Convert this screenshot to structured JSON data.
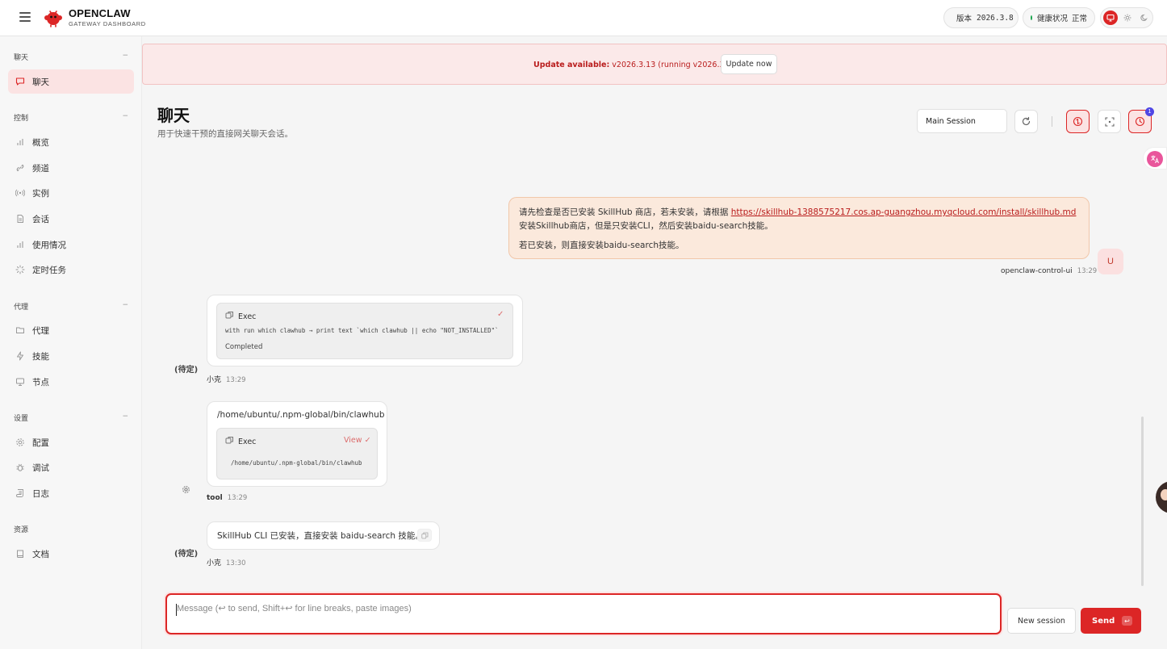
{
  "brand": {
    "title": "OPENCLAW",
    "subtitle": "GATEWAY DASHBOARD"
  },
  "status": {
    "version_label": "版本",
    "version_value": "2026.3.8",
    "version_dot_color": "#f59e0b",
    "health_label": "健康状况",
    "health_value": "正常",
    "health_dot_color": "#16a34a"
  },
  "theme": {
    "options": [
      "monitor-icon",
      "sun-icon",
      "moon-icon"
    ],
    "active": "monitor-icon"
  },
  "sidebar": {
    "sections": [
      {
        "title": "聊天",
        "items": [
          {
            "label": "聊天",
            "icon": "chat-bubble-icon",
            "active": true
          }
        ]
      },
      {
        "title": "控制",
        "items": [
          {
            "label": "概览",
            "icon": "bar-chart-icon"
          },
          {
            "label": "频道",
            "icon": "link-icon"
          },
          {
            "label": "实例",
            "icon": "radio-icon"
          },
          {
            "label": "会话",
            "icon": "document-icon"
          },
          {
            "label": "使用情况",
            "icon": "bar-chart-icon"
          },
          {
            "label": "定时任务",
            "icon": "loader-icon"
          }
        ]
      },
      {
        "title": "代理",
        "items": [
          {
            "label": "代理",
            "icon": "folder-icon"
          },
          {
            "label": "技能",
            "icon": "lightning-icon"
          },
          {
            "label": "节点",
            "icon": "monitor-icon"
          }
        ]
      },
      {
        "title": "设置",
        "items": [
          {
            "label": "配置",
            "icon": "gear-icon"
          },
          {
            "label": "调试",
            "icon": "bug-icon"
          },
          {
            "label": "日志",
            "icon": "scroll-icon"
          }
        ]
      },
      {
        "title": "资源",
        "items": [
          {
            "label": "文档",
            "icon": "book-icon"
          }
        ]
      }
    ],
    "collapse_glyph": "−"
  },
  "banner": {
    "prefix": "Update available:",
    "message": " v2026.3.13 (running v2026.3.8).",
    "button": "Update now"
  },
  "page": {
    "title": "聊天",
    "subtitle": "用于快速干预的直接网关聊天会话。",
    "session_select": "Main Session",
    "notification_count": "1"
  },
  "messages": {
    "user": {
      "line1_prefix": "请先检查是否已安装 SkillHub 商店，若未安装，请根据 ",
      "link": "https://skillhub-1388575217.cos.ap-guangzhou.myqcloud.com/install/skillhub.md",
      "line1_suffix": " 安装Skillhub商店，但是只安装CLI，然后安装baidu-search技能。",
      "line2": "若已安装，则直接安装baidu-search技能。",
      "sender": "openclaw-control-ui",
      "time": "13:29",
      "avatar": "U"
    },
    "assistant1": {
      "pending": "(待定)",
      "tool_name": "Exec",
      "command": "with run which clawhub → print text `which clawhub || echo \"NOT_INSTALLED\"`",
      "status": "Completed",
      "sender": "小克",
      "time": "13:29"
    },
    "tool": {
      "output_path": "/home/ubuntu/.npm-global/bin/clawhub",
      "tool_name": "Exec",
      "view_label": "View",
      "command": "/home/ubuntu/.npm-global/bin/clawhub",
      "sender": "tool",
      "time": "13:29"
    },
    "assistant2": {
      "pending": "(待定)",
      "text": "SkillHub CLI 已安装，直接安装 baidu-search 技能。",
      "sender": "小克",
      "time": "13:30"
    }
  },
  "composer": {
    "placeholder": "Message (↩ to send, Shift+↩ for line breaks, paste images)",
    "new_session": "New session",
    "send": "Send",
    "send_shortcut": "↩"
  },
  "colors": {
    "accent": "#dc2626",
    "banner_bg": "#fbe9e9",
    "user_bubble": "#fbe9dc"
  }
}
